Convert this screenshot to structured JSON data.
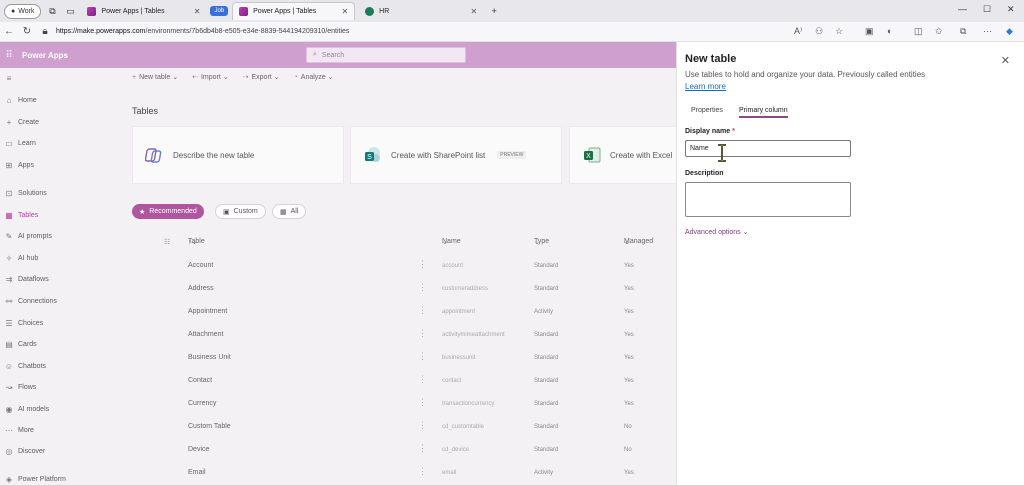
{
  "browser": {
    "profile": "Work",
    "tabs": [
      {
        "label": "Power Apps | Tables",
        "active": false
      },
      {
        "label": "Power Apps | Tables",
        "active": true
      },
      {
        "label": "HR",
        "active": false
      }
    ],
    "tab_group": "Job",
    "url_host": "https://make.powerapps.com",
    "url_path": "/environments/7b6db4b8-e505-e34e-8839-544194209310/entities"
  },
  "app": {
    "name": "Power Apps",
    "search_placeholder": "Search"
  },
  "sidebar": {
    "items": [
      {
        "label": "Home",
        "icon": "home-icon"
      },
      {
        "label": "Create",
        "icon": "plus-icon"
      },
      {
        "label": "Learn",
        "icon": "book-icon"
      },
      {
        "label": "Apps",
        "icon": "apps-icon"
      },
      {
        "label": "Solutions",
        "icon": "solutions-icon"
      },
      {
        "label": "Tables",
        "icon": "table-icon"
      },
      {
        "label": "AI prompts",
        "icon": "prompt-icon"
      },
      {
        "label": "AI hub",
        "icon": "ai-hub-icon"
      },
      {
        "label": "Dataflows",
        "icon": "dataflow-icon"
      },
      {
        "label": "Connections",
        "icon": "connection-icon"
      },
      {
        "label": "Choices",
        "icon": "choices-icon"
      },
      {
        "label": "Cards",
        "icon": "cards-icon"
      },
      {
        "label": "Chatbots",
        "icon": "chatbot-icon"
      },
      {
        "label": "Flows",
        "icon": "flow-icon"
      },
      {
        "label": "AI models",
        "icon": "ai-models-icon"
      },
      {
        "label": "More",
        "icon": "more-icon"
      },
      {
        "label": "Discover",
        "icon": "discover-icon"
      },
      {
        "label": "Power Platform",
        "icon": "power-platform-icon"
      }
    ]
  },
  "toolbar": {
    "new_table": "New table",
    "import": "Import",
    "export": "Export",
    "analyze": "Analyze"
  },
  "main": {
    "heading": "Tables",
    "cards": [
      {
        "label": "Describe the new table",
        "badge": ""
      },
      {
        "label": "Create with SharePoint list",
        "badge": "PREVIEW"
      },
      {
        "label": "Create with Excel",
        "badge": ""
      }
    ],
    "filters": [
      "Recommended",
      "Custom",
      "All"
    ],
    "columns": {
      "table": "Table",
      "name": "Name",
      "type": "Type",
      "managed": "Managed"
    },
    "rows": [
      {
        "table": "Account",
        "name": "account",
        "type": "Standard",
        "managed": "Yes"
      },
      {
        "table": "Address",
        "name": "customeraddress",
        "type": "Standard",
        "managed": "Yes"
      },
      {
        "table": "Appointment",
        "name": "appointment",
        "type": "Activity",
        "managed": "Yes"
      },
      {
        "table": "Attachment",
        "name": "activitymimeattachment",
        "type": "Standard",
        "managed": "Yes"
      },
      {
        "table": "Business Unit",
        "name": "businessunit",
        "type": "Standard",
        "managed": "Yes"
      },
      {
        "table": "Contact",
        "name": "contact",
        "type": "Standard",
        "managed": "Yes"
      },
      {
        "table": "Currency",
        "name": "transactioncurrency",
        "type": "Standard",
        "managed": "Yes"
      },
      {
        "table": "Custom Table",
        "name": "cd_customtable",
        "type": "Standard",
        "managed": "No"
      },
      {
        "table": "Device",
        "name": "cd_device",
        "type": "Standard",
        "managed": "No"
      },
      {
        "table": "Email",
        "name": "email",
        "type": "Activity",
        "managed": "Yes"
      }
    ]
  },
  "panel": {
    "title": "New table",
    "subtitle": "Use tables to hold and organize your data. Previously called entities",
    "learn_more": "Learn more",
    "tabs": [
      "Properties",
      "Primary column"
    ],
    "display_name_label": "Display name",
    "required_mark": "*",
    "display_name_value": "Name",
    "description_label": "Description",
    "advanced_options": "Advanced options"
  },
  "colors": {
    "brand": "#742774",
    "accent": "#b0569f",
    "link": "#0f6cbd"
  }
}
